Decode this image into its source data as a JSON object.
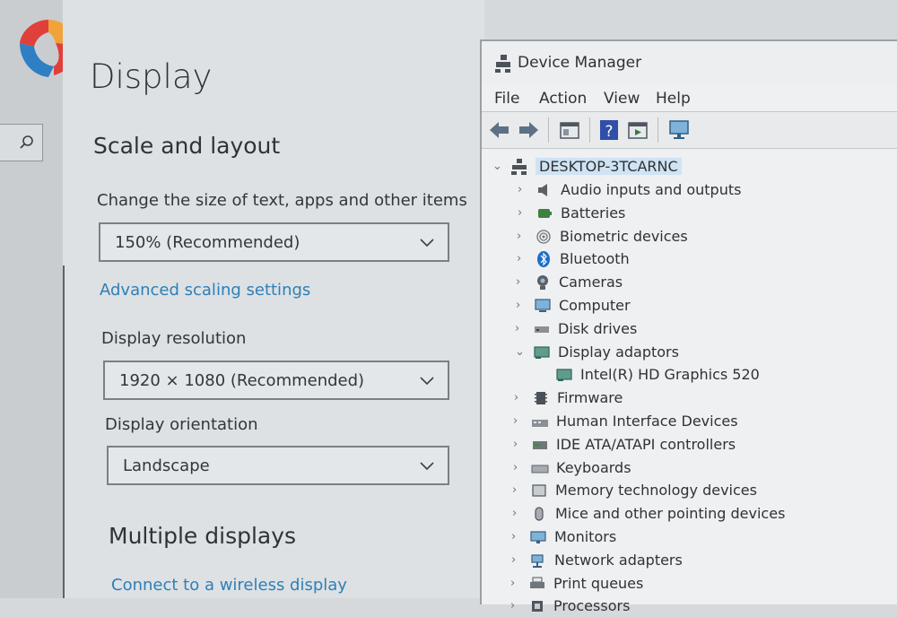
{
  "settings": {
    "page_title": "Display",
    "scale_section": "Scale and layout",
    "scale_label": "Change the size of text, apps and other items",
    "scale_value": "150% (Recommended)",
    "advanced_link": "Advanced scaling settings",
    "resolution_label": "Display resolution",
    "resolution_value": "1920 × 1080 (Recommended)",
    "orientation_label": "Display orientation",
    "orientation_value": "Landscape",
    "multiple_section": "Multiple displays",
    "wireless_link": "Connect to a wireless display"
  },
  "device_manager": {
    "title": "Device Manager",
    "menu": [
      "File",
      "Action",
      "View",
      "Help"
    ],
    "root": "DESKTOP-3TCARNC",
    "items": [
      {
        "label": "Audio inputs and outputs",
        "icon": "speaker-icon",
        "expanded": false
      },
      {
        "label": "Batteries",
        "icon": "battery-icon",
        "expanded": false
      },
      {
        "label": "Biometric devices",
        "icon": "fingerprint-icon",
        "expanded": false
      },
      {
        "label": "Bluetooth",
        "icon": "bluetooth-icon",
        "expanded": false
      },
      {
        "label": "Cameras",
        "icon": "camera-icon",
        "expanded": false
      },
      {
        "label": "Computer",
        "icon": "computer-icon",
        "expanded": false
      },
      {
        "label": "Disk drives",
        "icon": "disk-icon",
        "expanded": false
      },
      {
        "label": "Display adaptors",
        "icon": "display-adapter-icon",
        "expanded": true
      },
      {
        "label": "Intel(R) HD Graphics 520",
        "icon": "display-adapter-icon",
        "child": true
      },
      {
        "label": "Firmware",
        "icon": "firmware-icon",
        "expanded": false
      },
      {
        "label": "Human Interface Devices",
        "icon": "hid-icon",
        "expanded": false
      },
      {
        "label": "IDE ATA/ATAPI controllers",
        "icon": "ide-icon",
        "expanded": false
      },
      {
        "label": "Keyboards",
        "icon": "keyboard-icon",
        "expanded": false
      },
      {
        "label": "Memory technology devices",
        "icon": "memory-icon",
        "expanded": false
      },
      {
        "label": "Mice and other pointing devices",
        "icon": "mouse-icon",
        "expanded": false
      },
      {
        "label": "Monitors",
        "icon": "monitor-icon",
        "expanded": false
      },
      {
        "label": "Network adapters",
        "icon": "network-icon",
        "expanded": false
      },
      {
        "label": "Print queues",
        "icon": "printer-icon",
        "expanded": false
      },
      {
        "label": "Processors",
        "icon": "processor-icon",
        "expanded": false
      }
    ]
  },
  "colors": {
    "link": "#2f7fb6",
    "logo_red": "#e0403a",
    "logo_orange": "#f2a23a",
    "logo_blue": "#2e7fc4"
  }
}
